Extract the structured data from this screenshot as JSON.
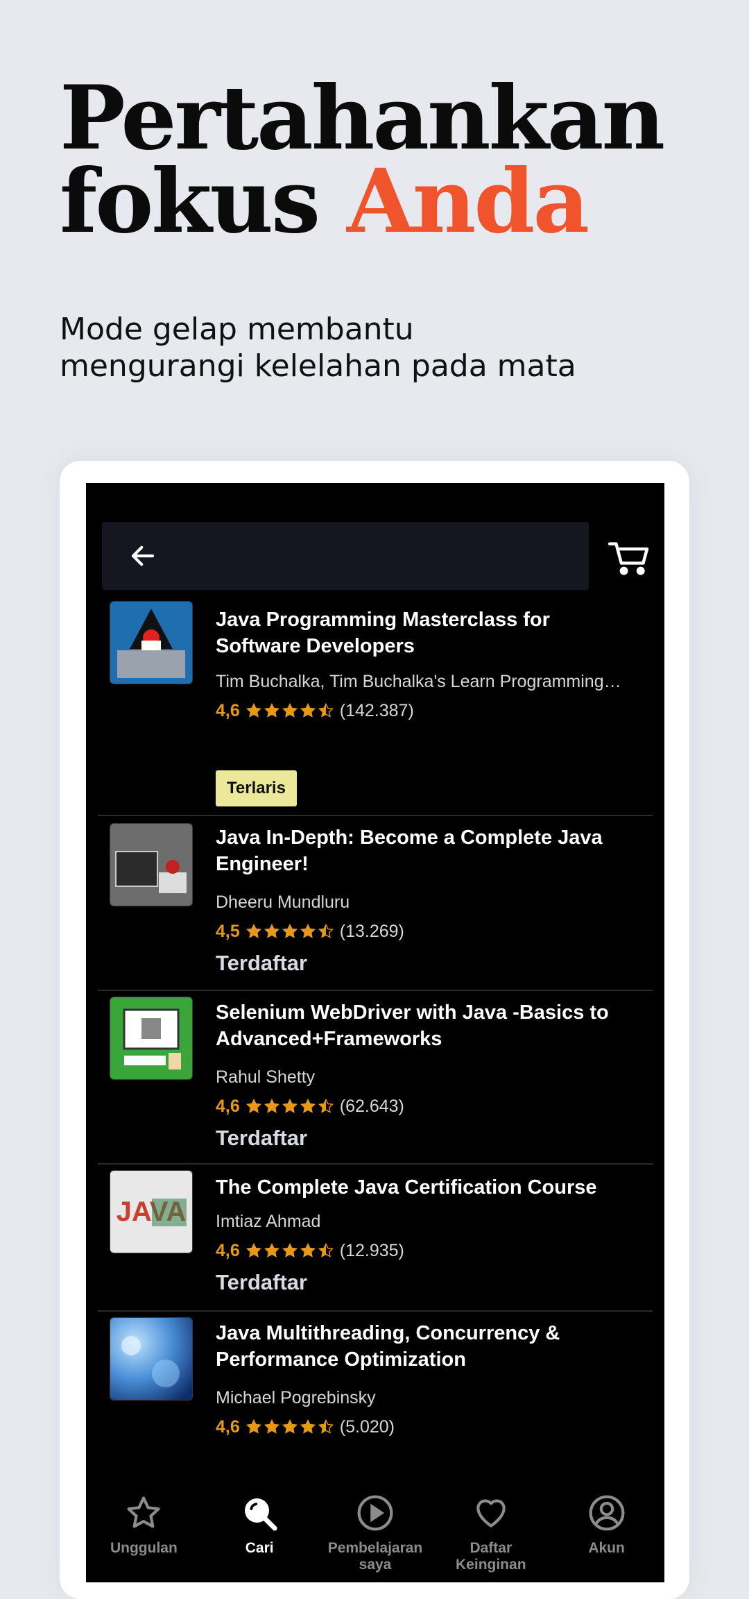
{
  "headline": {
    "line1": "Pertahankan",
    "line2_plain": "fokus ",
    "line2_accent": "Anda"
  },
  "subtitle": {
    "line1": "Mode gelap membantu",
    "line2": "mengurangi kelelahan pada mata"
  },
  "colors": {
    "accent": "#f0542d",
    "rating": "#e59819",
    "badge": "#ece89b",
    "background": "#e8e9ee"
  },
  "search": {
    "back_icon": "arrow-left-icon",
    "cart_icon": "cart-icon"
  },
  "courses": [
    {
      "title": "Java Programming Masterclass for Software Developers",
      "author": "Tim Buchalka, Tim Buchalka's Learn Programming…",
      "rating": "4,6",
      "count": "(142.387)",
      "stars": 4.5,
      "badge": "Terlaris"
    },
    {
      "title": "Java In-Depth: Become a Complete Java Engineer!",
      "author": "Dheeru Mundluru",
      "rating": "4,5",
      "count": "(13.269)",
      "stars": 4.5,
      "status": "Terdaftar"
    },
    {
      "title": "Selenium WebDriver with Java -Basics to Advanced+Frameworks",
      "author": "Rahul Shetty",
      "rating": "4,6",
      "count": "(62.643)",
      "stars": 4.5,
      "status": "Terdaftar"
    },
    {
      "title": "The Complete Java Certification Course",
      "author": "Imtiaz Ahmad",
      "rating": "4,6",
      "count": "(12.935)",
      "stars": 4.5,
      "status": "Terdaftar"
    },
    {
      "title": "Java Multithreading, Concurrency & Performance Optimization",
      "author": "Michael Pogrebinsky",
      "rating": "4,6",
      "count": "(5.020)",
      "stars": 4.5
    }
  ],
  "nav": [
    {
      "label": "Unggulan",
      "icon": "star-icon",
      "active": false
    },
    {
      "label": "Cari",
      "icon": "search-icon",
      "active": true
    },
    {
      "label": "Pembelajaran saya",
      "icon": "play-icon",
      "active": false
    },
    {
      "label": "Daftar Keinginan",
      "icon": "heart-icon",
      "active": false
    },
    {
      "label": "Akun",
      "icon": "account-icon",
      "active": false
    }
  ]
}
